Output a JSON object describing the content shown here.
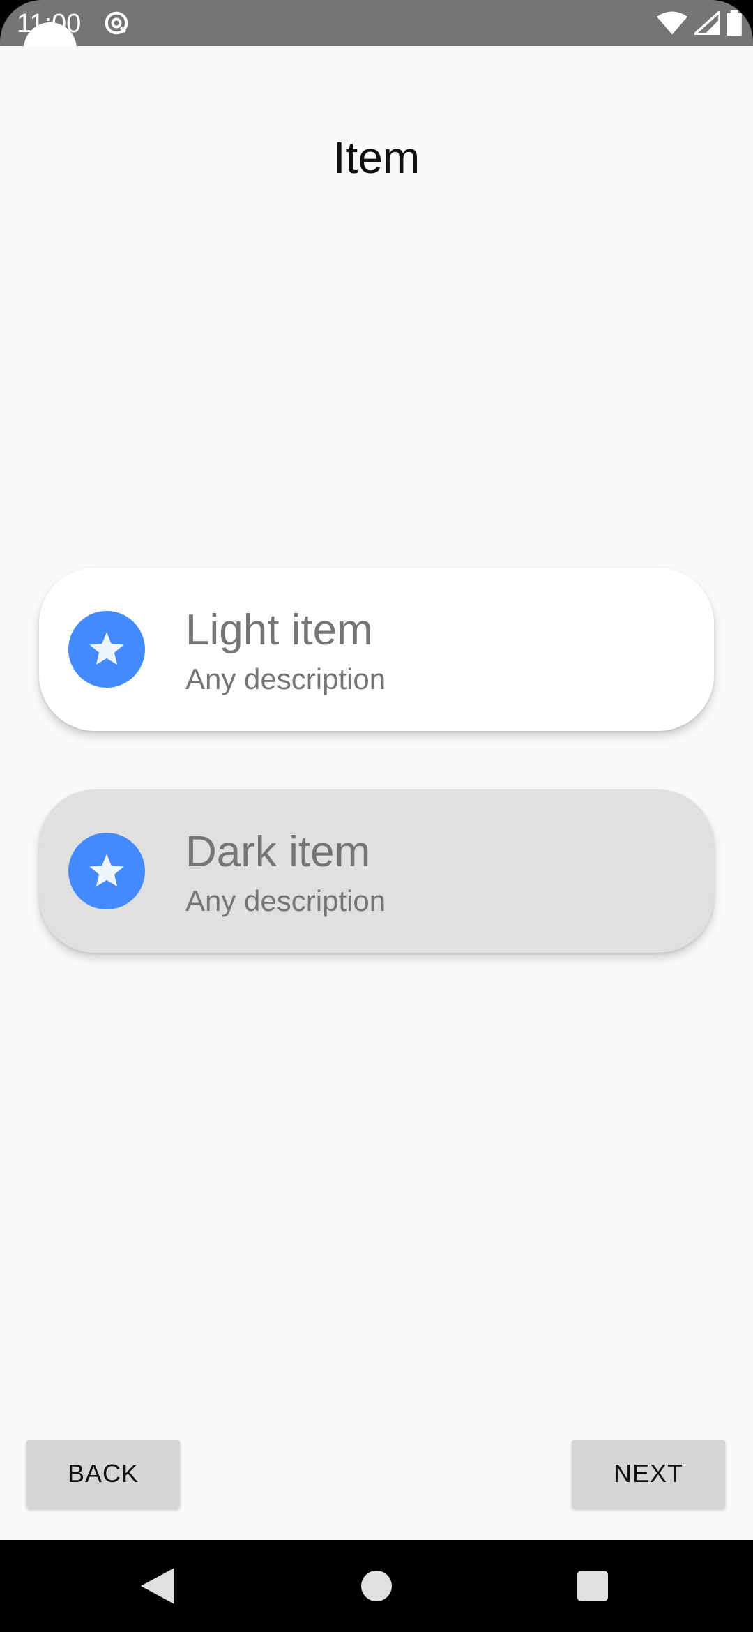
{
  "status_bar": {
    "time": "11:00",
    "app_icon": "at-sign-icon",
    "icons": [
      "wifi-icon",
      "signal-icon",
      "battery-icon"
    ],
    "background": "#757575"
  },
  "page": {
    "title": "Item",
    "background": "#fafafa"
  },
  "items": [
    {
      "title": "Light item",
      "description": "Any description",
      "icon": "star-icon",
      "background": "#ffffff"
    },
    {
      "title": "Dark item",
      "description": "Any description",
      "icon": "star-icon",
      "background": "#e0e0e0"
    }
  ],
  "buttons": {
    "back_label": "BACK",
    "next_label": "NEXT"
  },
  "nav_bar": {
    "icons": [
      "back-triangle-icon",
      "home-circle-icon",
      "recents-square-icon"
    ]
  },
  "colors": {
    "accent": "#448aff",
    "text_secondary": "#757575"
  }
}
